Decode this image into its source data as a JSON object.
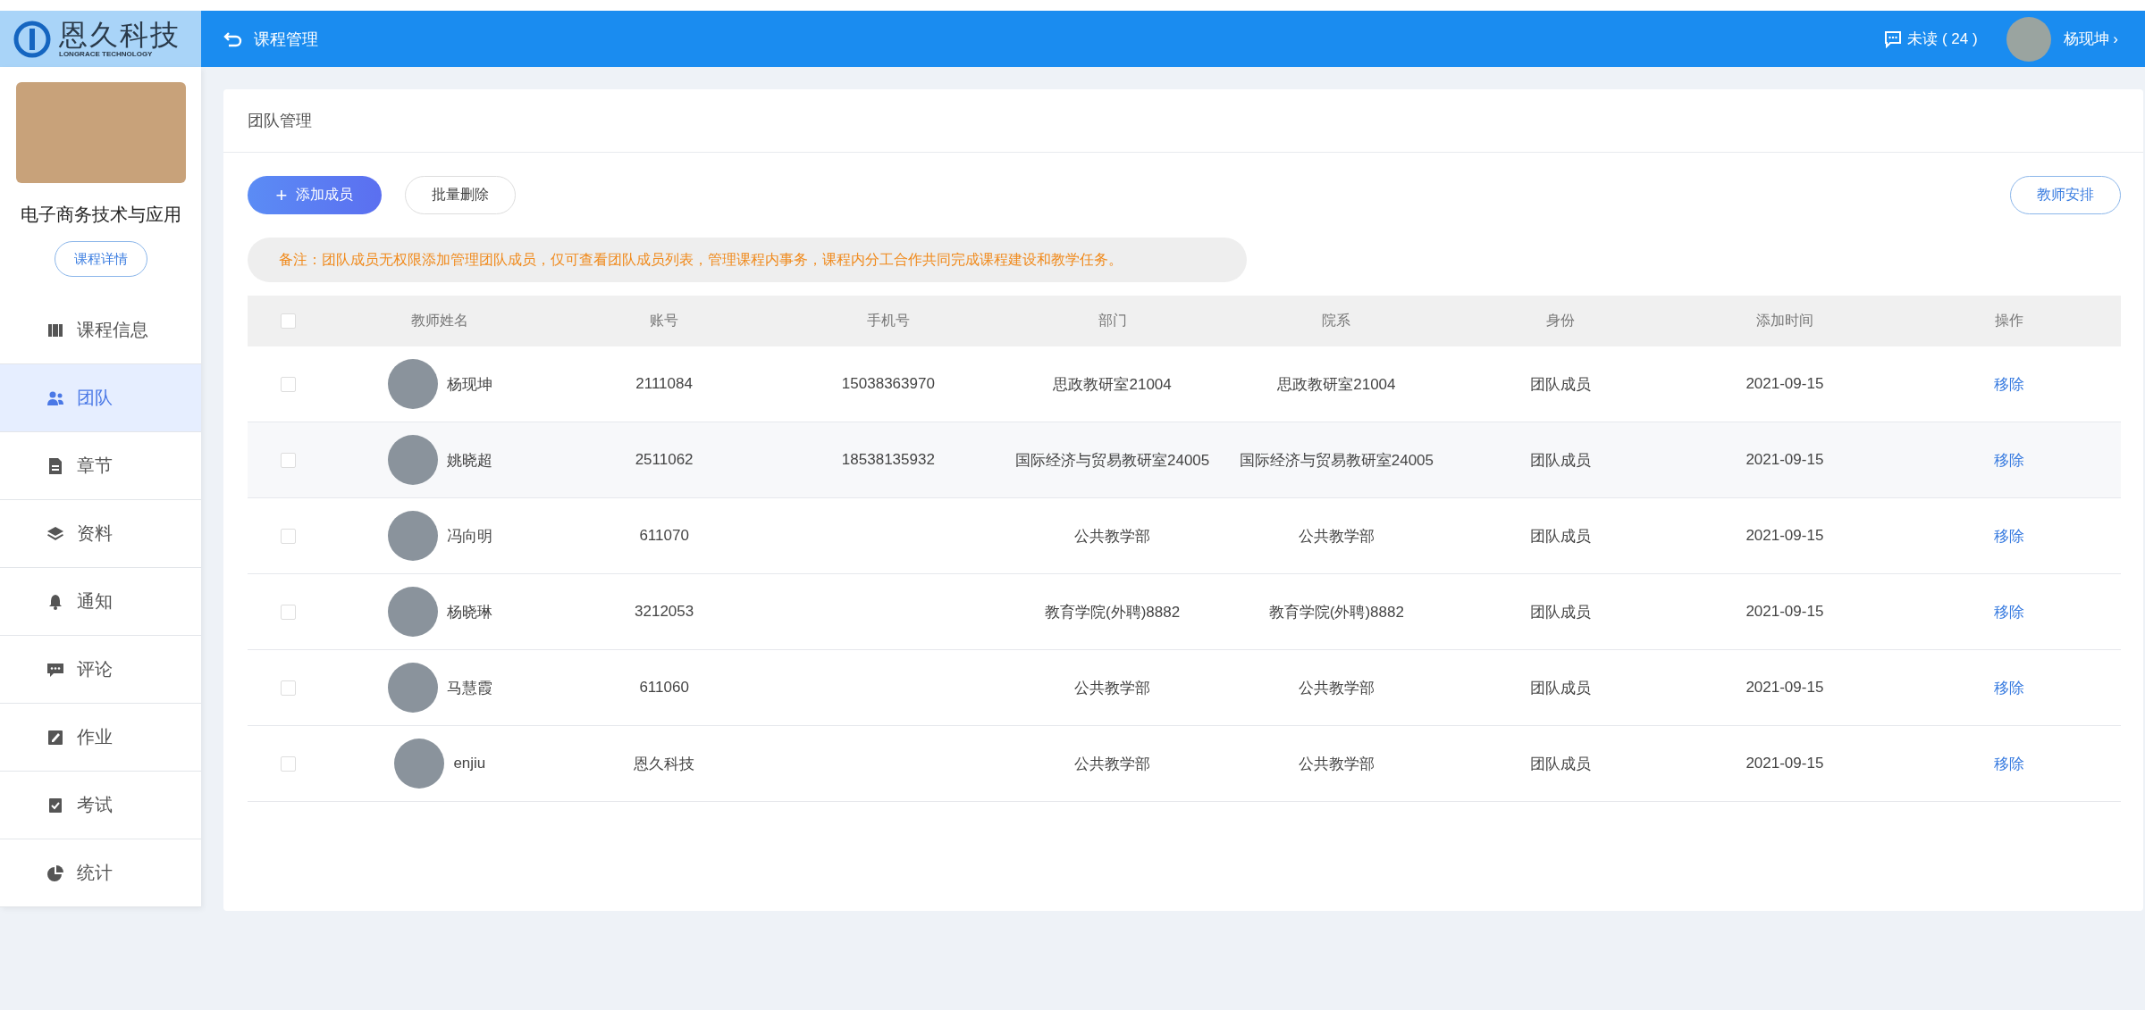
{
  "header": {
    "logo": {
      "name": "恩久科技",
      "subtitle": "LONGRACE TECHNOLOGY"
    },
    "back_title": "课程管理",
    "unread": "未读 ( 24 )",
    "user": "杨现坤",
    "user_caret": "›"
  },
  "sidebar": {
    "course_title": "电子商务技术与应用",
    "details_button": "课程详情",
    "items": [
      {
        "label": "课程信息",
        "selected": false
      },
      {
        "label": "团队",
        "selected": true
      },
      {
        "label": "章节",
        "selected": false
      },
      {
        "label": "资料",
        "selected": false
      },
      {
        "label": "通知",
        "selected": false
      },
      {
        "label": "评论",
        "selected": false
      },
      {
        "label": "作业",
        "selected": false
      },
      {
        "label": "考试",
        "selected": false
      },
      {
        "label": "统计",
        "selected": false
      }
    ]
  },
  "panel": {
    "title": "团队管理",
    "add_button": "添加成员",
    "add_icon": "+",
    "batch_delete_button": "批量删除",
    "arrange_button": "教师安排",
    "note": "备注：团队成员无权限添加管理团队成员，仅可查看团队成员列表，管理课程内事务，课程内分工合作共同完成课程建设和教学任务。"
  },
  "table": {
    "all_checked": false,
    "columns": [
      "教师姓名",
      "账号",
      "手机号",
      "部门",
      "院系",
      "身份",
      "添加时间",
      "操作"
    ],
    "rows": [
      {
        "checked": false,
        "name": "杨现坤",
        "account": "2111084",
        "phone": "15038363970",
        "department": "思政教研室21004",
        "faculty": "思政教研室21004",
        "role": "团队成员",
        "added": "2021-09-15",
        "action": "移除"
      },
      {
        "checked": false,
        "name": "姚晓超",
        "account": "2511062",
        "phone": "18538135932",
        "department": "国际经济与贸易教研室24005",
        "faculty": "国际经济与贸易教研室24005",
        "role": "团队成员",
        "added": "2021-09-15",
        "action": "移除"
      },
      {
        "checked": false,
        "name": "冯向明",
        "account": "611070",
        "department": "公共教学部",
        "faculty": "公共教学部",
        "role": "团队成员",
        "added": "2021-09-15",
        "action": "移除"
      },
      {
        "checked": false,
        "name": "杨晓琳",
        "account": "3212053",
        "department": "教育学院(外聘)8882",
        "faculty": "教育学院(外聘)8882",
        "role": "团队成员",
        "added": "2021-09-15",
        "action": "移除"
      },
      {
        "checked": false,
        "name": "马慧霞",
        "account": "611060",
        "department": "公共教学部",
        "faculty": "公共教学部",
        "role": "团队成员",
        "added": "2021-09-15",
        "action": "移除"
      },
      {
        "checked": false,
        "name": "enjiu",
        "account": "恩久科技",
        "department": "公共教学部",
        "faculty": "公共教学部",
        "role": "团队成员",
        "added": "2021-09-15",
        "action": "移除"
      }
    ]
  }
}
